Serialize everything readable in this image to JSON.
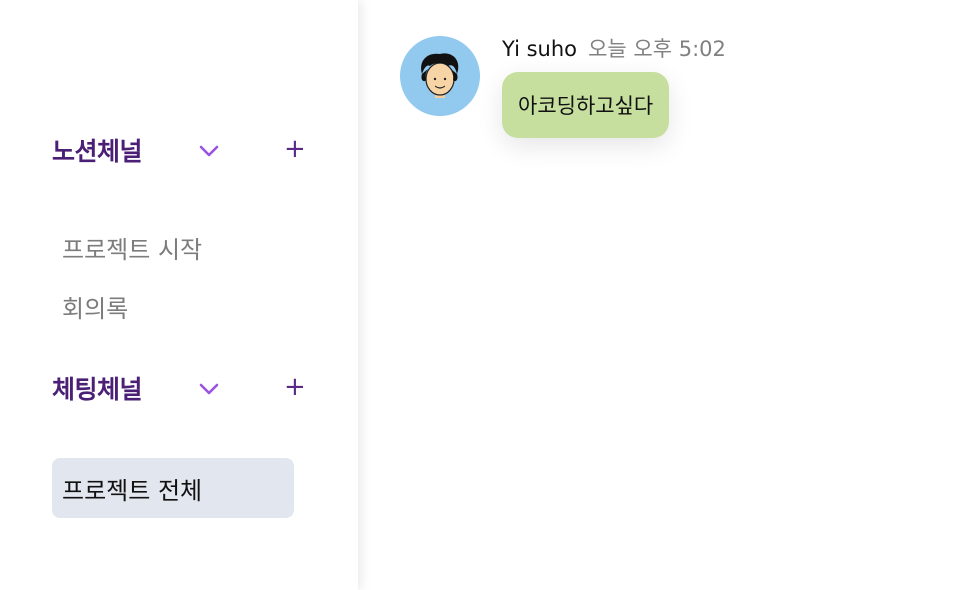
{
  "sidebar": {
    "notion_section": {
      "title": "노션체널",
      "chevron_icon": "chevron-down-icon",
      "add_icon": "plus-icon"
    },
    "notion_items": [
      "프로젝트 시작",
      "회의록"
    ],
    "chat_section": {
      "title": "체팅체널",
      "chevron_icon": "chevron-down-icon",
      "add_icon": "plus-icon"
    },
    "chat_items": [
      "프로젝트 전체"
    ],
    "active_item": "프로젝트 전체"
  },
  "chat": {
    "messages": [
      {
        "sender": "Yi suho",
        "time": "오늘 오후 5:02",
        "text": "아코딩하고싶다",
        "avatar_icon": "user-avatar-icon"
      }
    ]
  },
  "colors": {
    "section_title": "#4a1f75",
    "chevron": "#9a52e0",
    "plus": "#5b2a86",
    "active_item_bg": "#e2e6ef",
    "bubble_bg": "#c6df9f",
    "avatar_bg": "#92c9ee"
  }
}
